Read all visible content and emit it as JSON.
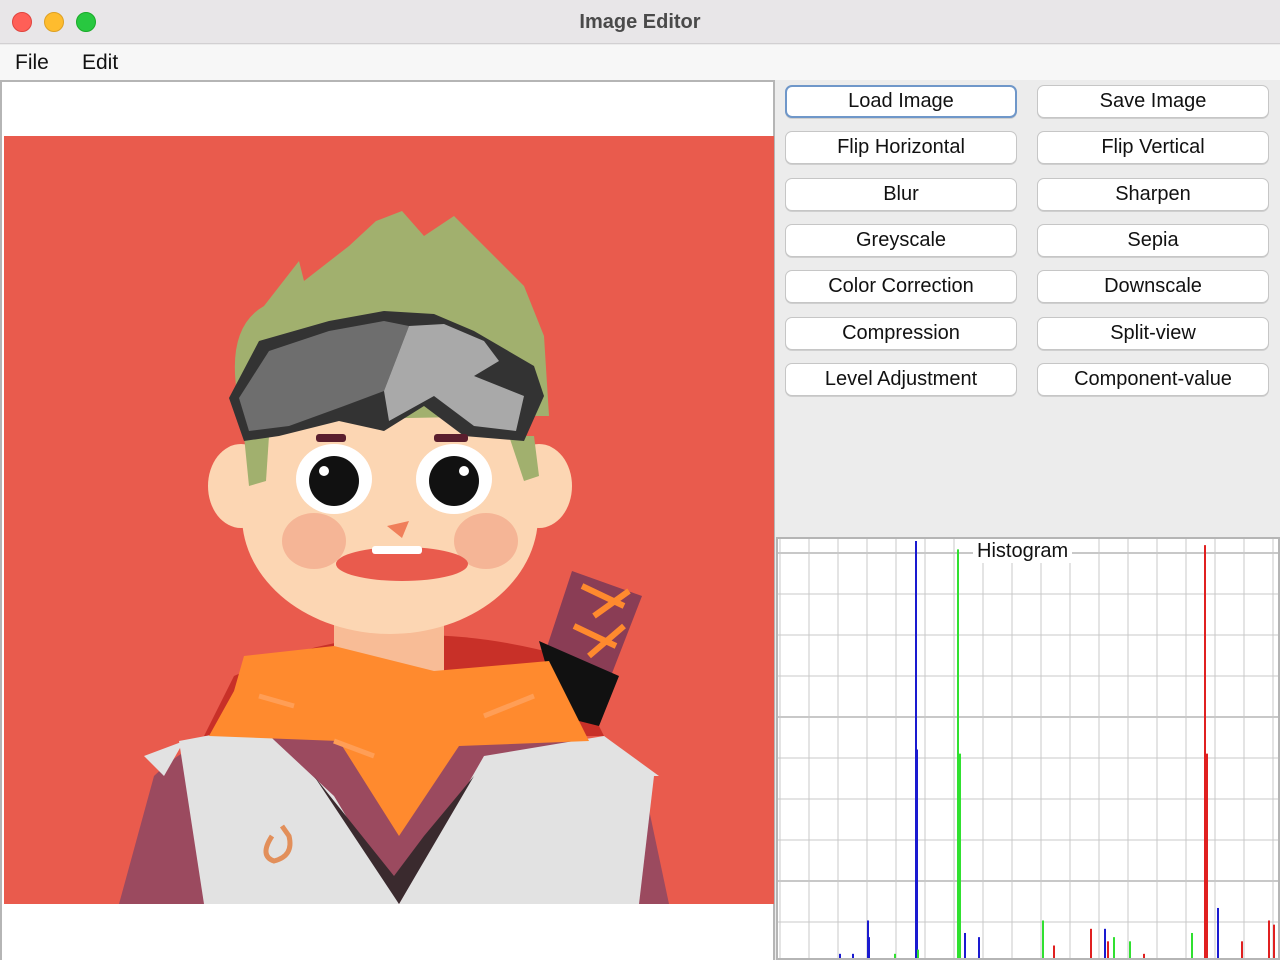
{
  "window": {
    "title": "Image Editor"
  },
  "menu": {
    "file": "File",
    "edit": "Edit"
  },
  "buttons": {
    "load_image": "Load Image",
    "save_image": "Save Image",
    "flip_horizontal": "Flip Horizontal",
    "flip_vertical": "Flip Vertical",
    "blur": "Blur",
    "sharpen": "Sharpen",
    "greyscale": "Greyscale",
    "sepia": "Sepia",
    "color_correction": "Color Correction",
    "downscale": "Downscale",
    "compression": "Compression",
    "split_view": "Split-view",
    "level_adjustment": "Level Adjustment",
    "component_value": "Component-value"
  },
  "histogram": {
    "title": "Histogram",
    "colors": {
      "red": "#e02020",
      "green": "#30e030",
      "blue": "#1a1ad0",
      "grid": "#c8c8c8"
    }
  },
  "colors": {
    "background": "#e95b4d",
    "hair": "#a1b06e",
    "skin": "#fcd6b3",
    "scarf": "#ff8a2e",
    "shirt": "#e2e2e2",
    "jacket": "#9b4a5f"
  }
}
